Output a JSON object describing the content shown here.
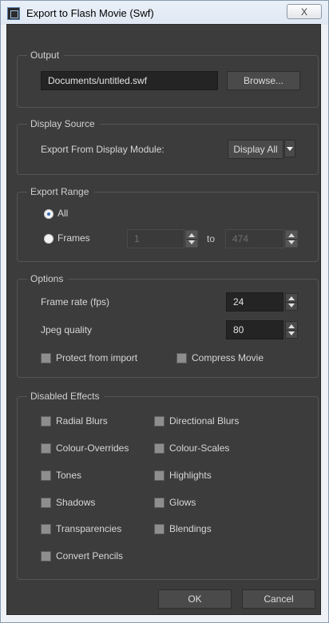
{
  "window": {
    "title": "Export to Flash Movie (Swf)",
    "close_label": "X"
  },
  "output": {
    "group_label": "Output",
    "path": "Documents/untitled.swf",
    "browse_label": "Browse..."
  },
  "display_source": {
    "group_label": "Display Source",
    "label": "Export From Display Module:",
    "selected": "Display All"
  },
  "export_range": {
    "group_label": "Export Range",
    "all_label": "All",
    "frames_label": "Frames",
    "from": "1",
    "to_label": "to",
    "to": "474",
    "selected": "All"
  },
  "options": {
    "group_label": "Options",
    "frame_rate_label": "Frame rate (fps)",
    "frame_rate": "24",
    "jpeg_label": "Jpeg quality",
    "jpeg": "80",
    "protect_label": "Protect from import",
    "compress_label": "Compress Movie"
  },
  "disabled_effects": {
    "group_label": "Disabled Effects",
    "items": [
      "Radial Blurs",
      "Directional Blurs",
      "Colour-Overrides",
      "Colour-Scales",
      "Tones",
      "Highlights",
      "Shadows",
      "Glows",
      "Transparencies",
      "Blendings",
      "Convert Pencils"
    ]
  },
  "buttons": {
    "ok": "OK",
    "cancel": "Cancel"
  },
  "colors": {
    "panel": "#3c3c3c",
    "field": "#242424",
    "radio_accent": "#3a6fb5"
  }
}
